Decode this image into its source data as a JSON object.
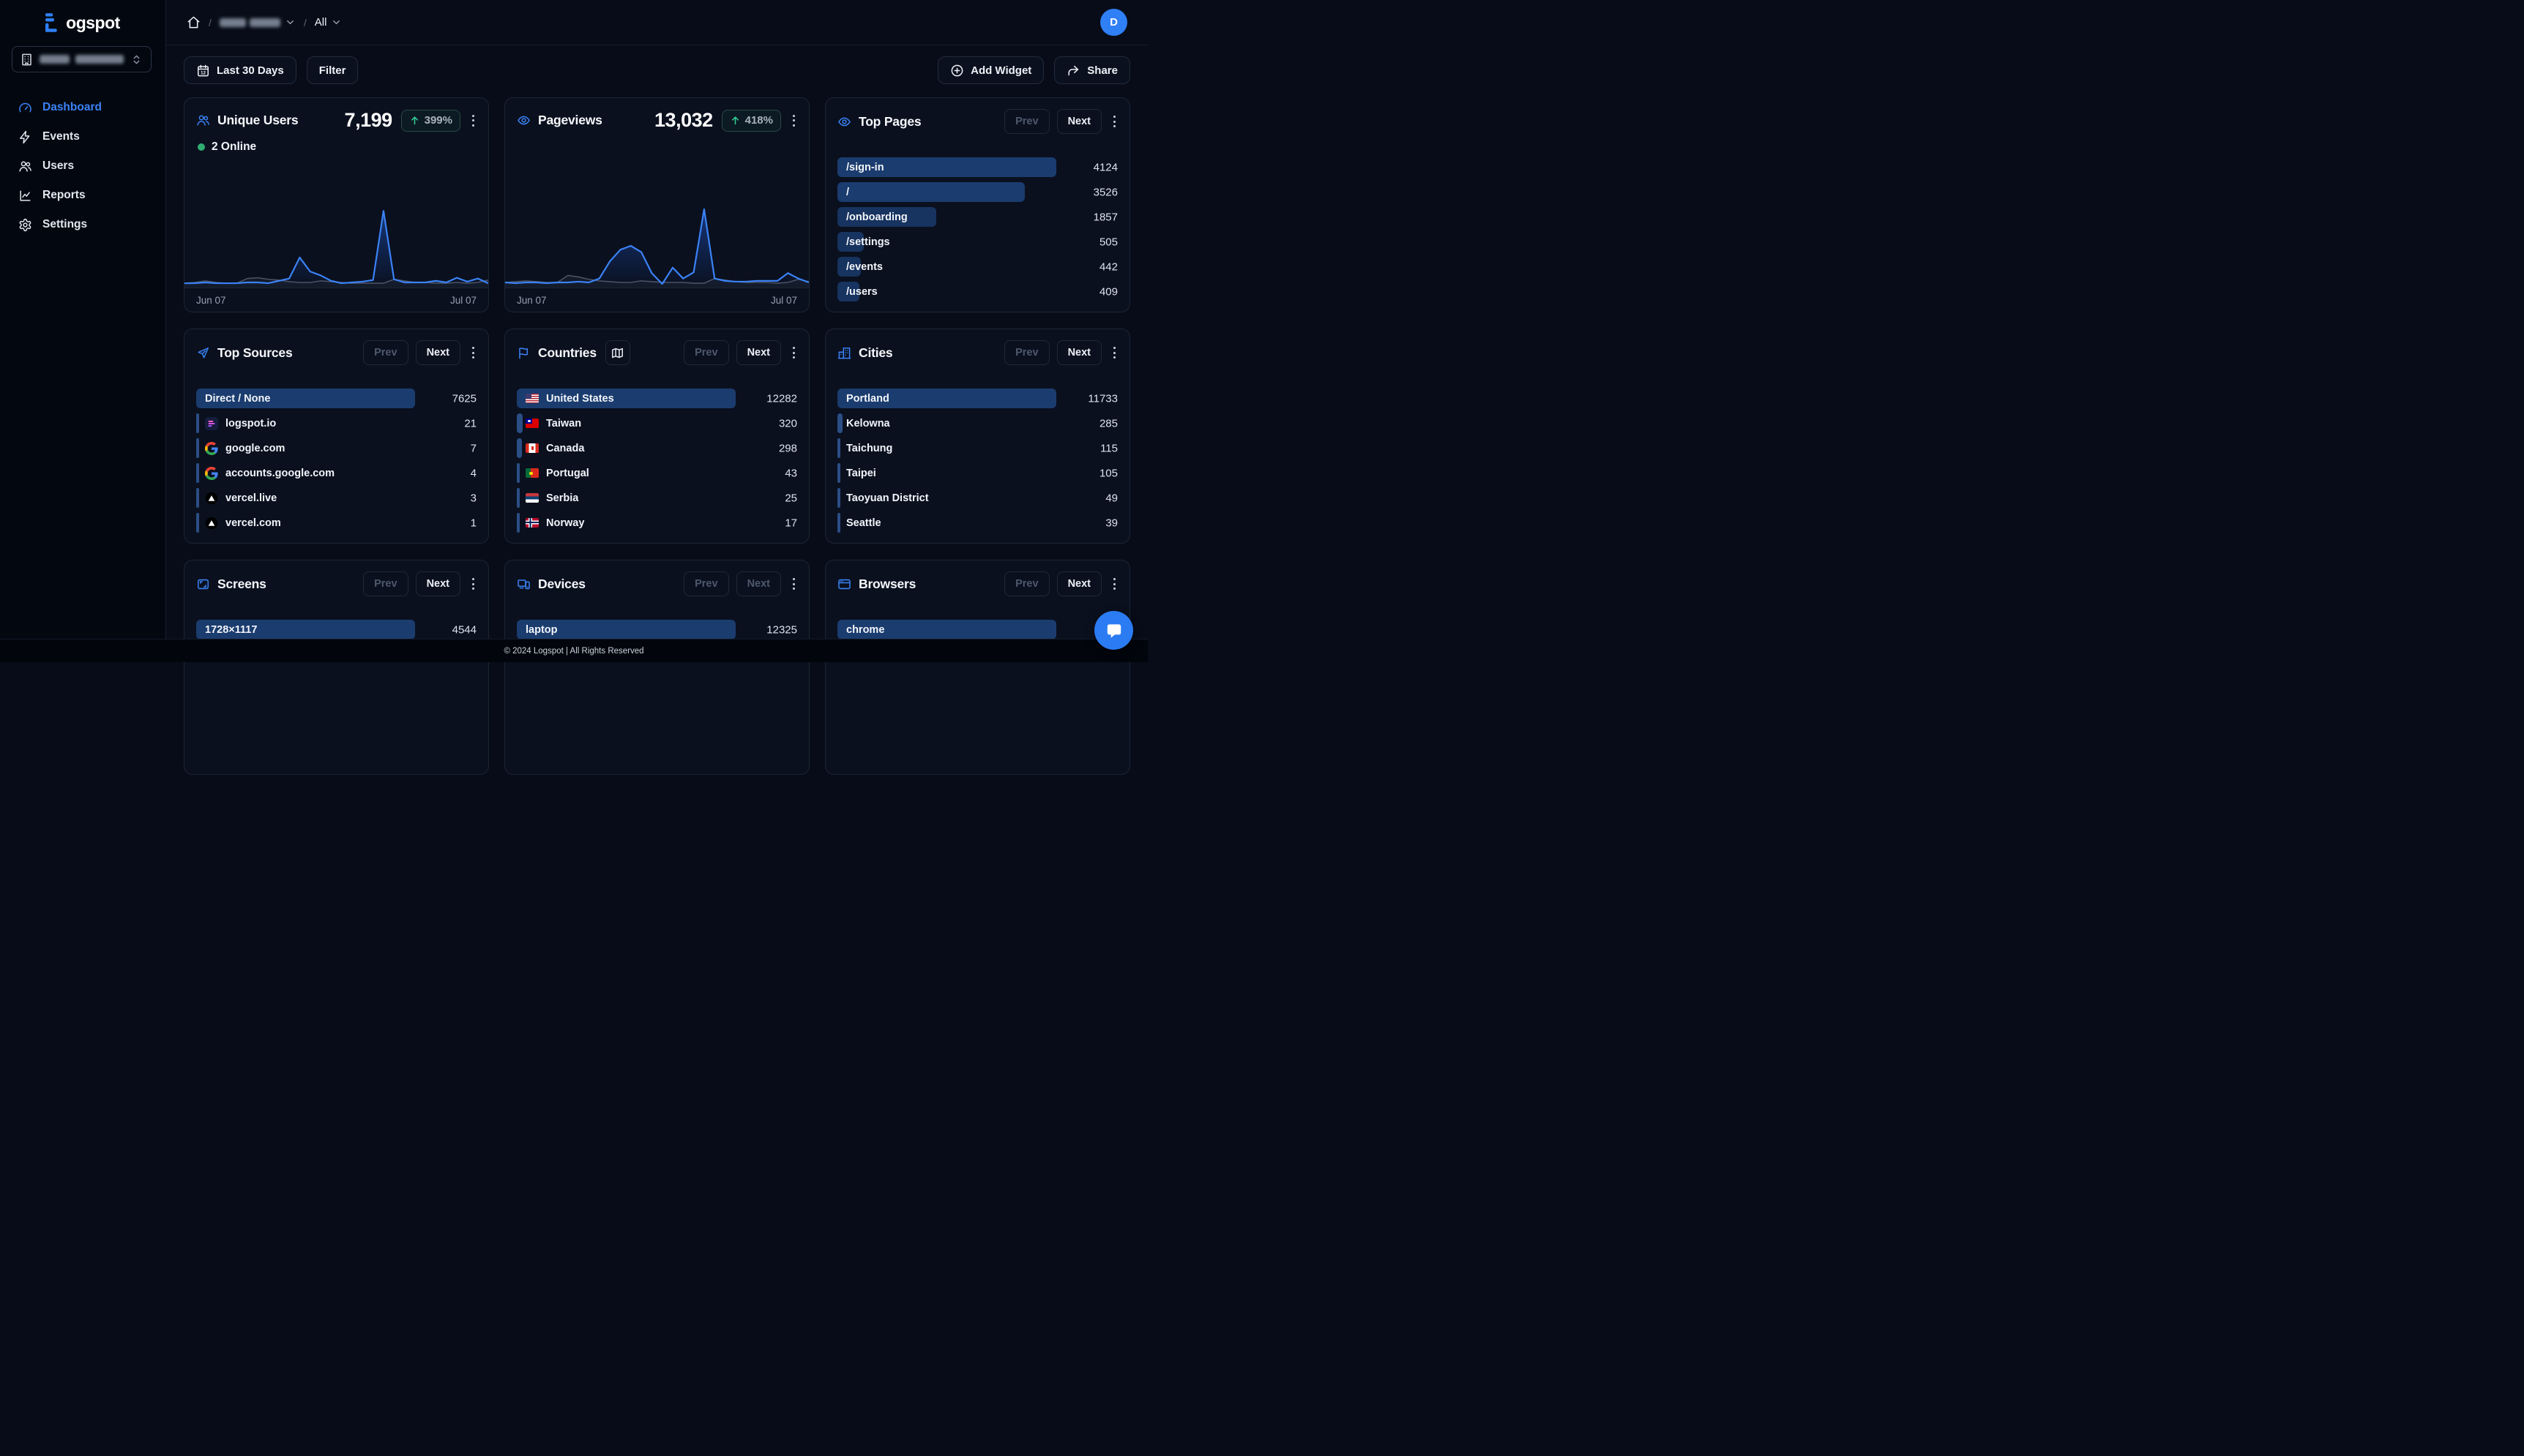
{
  "brand": {
    "name": "Logspot",
    "logo_suffix": "ogspot"
  },
  "colors": {
    "accent": "#3b82f6",
    "avatar": "#2f7ff6",
    "bar": "#17335f",
    "bar_max": "#1b3c6e",
    "bar_sliver": "#2b4e85",
    "green_up": "#34d399",
    "online_dot": "#2fae73",
    "card_bg": "#0a101e",
    "card_border": "#1d2636",
    "page_bg": "#070c18"
  },
  "sidebar": {
    "workspace": {
      "redacted": true
    },
    "nav": [
      {
        "id": "dashboard",
        "label": "Dashboard",
        "icon": "gauge",
        "active": true
      },
      {
        "id": "events",
        "label": "Events",
        "icon": "zap",
        "active": false
      },
      {
        "id": "users",
        "label": "Users",
        "icon": "users",
        "active": false
      },
      {
        "id": "reports",
        "label": "Reports",
        "icon": "chart",
        "active": false
      },
      {
        "id": "settings",
        "label": "Settings",
        "icon": "gear",
        "active": false
      }
    ]
  },
  "topbar": {
    "scope_label": "All",
    "avatar_initial": "D",
    "project_redacted": true
  },
  "toolbar": {
    "date_range": "Last 30 Days",
    "filter": "Filter",
    "add_widget": "Add Widget",
    "share": "Share"
  },
  "pager": {
    "prev": "Prev",
    "next": "Next"
  },
  "grid_order": [
    "unique-users",
    "pageviews",
    "top-pages",
    "top-sources",
    "countries",
    "cities",
    "screens",
    "devices",
    "browsers"
  ],
  "stat_cards": [
    {
      "id": "unique-users",
      "title": "Unique Users",
      "icon": "users",
      "value": "7,199",
      "change": "399%",
      "online": "2 Online",
      "x_start": "Jun 07",
      "x_end": "Jul 07"
    },
    {
      "id": "pageviews",
      "title": "Pageviews",
      "icon": "eye",
      "value": "13,032",
      "change": "418%",
      "x_start": "Jun 07",
      "x_end": "Jul 07"
    }
  ],
  "chart_data": [
    {
      "type": "area",
      "card": "unique-users",
      "title": "Unique Users last 30 days",
      "x_range": [
        "Jun 07",
        "Jul 07"
      ],
      "ylim": [
        0,
        1
      ],
      "grid": false,
      "legend": "none",
      "series": [
        {
          "name": "current",
          "color": "#3b82f6",
          "values": [
            0.02,
            0.02,
            0.03,
            0.02,
            0.02,
            0.02,
            0.03,
            0.03,
            0.02,
            0.05,
            0.08,
            0.35,
            0.17,
            0.12,
            0.05,
            0.02,
            0.03,
            0.04,
            0.06,
            0.95,
            0.07,
            0.03,
            0.03,
            0.03,
            0.05,
            0.03,
            0.09,
            0.04,
            0.08,
            0.02
          ]
        },
        {
          "name": "previous",
          "color": "#4a5261",
          "values": [
            0.02,
            0.03,
            0.05,
            0.03,
            0.02,
            0.02,
            0.08,
            0.09,
            0.07,
            0.06,
            0.04,
            0.03,
            0.03,
            0.05,
            0.04,
            0.03,
            0.02,
            0.02,
            0.02,
            0.02,
            0.07,
            0.05,
            0.03,
            0.03,
            0.02,
            0.02,
            0.03,
            0.02,
            0.03,
            0.06
          ]
        }
      ]
    },
    {
      "type": "area",
      "card": "pageviews",
      "title": "Pageviews last 30 days",
      "x_range": [
        "Jun 07",
        "Jul 07"
      ],
      "ylim": [
        0,
        1
      ],
      "grid": false,
      "legend": "none",
      "series": [
        {
          "name": "current",
          "color": "#3b82f6",
          "values": [
            0.03,
            0.02,
            0.03,
            0.03,
            0.02,
            0.03,
            0.03,
            0.04,
            0.03,
            0.08,
            0.3,
            0.45,
            0.5,
            0.42,
            0.15,
            0.01,
            0.22,
            0.08,
            0.16,
            0.97,
            0.08,
            0.05,
            0.04,
            0.04,
            0.05,
            0.05,
            0.05,
            0.15,
            0.08,
            0.03
          ]
        },
        {
          "name": "previous",
          "color": "#4a5261",
          "values": [
            0.03,
            0.04,
            0.05,
            0.04,
            0.03,
            0.03,
            0.12,
            0.1,
            0.07,
            0.05,
            0.04,
            0.03,
            0.03,
            0.05,
            0.04,
            0.03,
            0.03,
            0.03,
            0.02,
            0.02,
            0.08,
            0.06,
            0.04,
            0.03,
            0.03,
            0.03,
            0.02,
            0.03,
            0.07,
            0.04
          ]
        }
      ]
    }
  ],
  "list_cards": [
    {
      "id": "top-pages",
      "title": "Top Pages",
      "icon": "eye",
      "prev_enabled": false,
      "next_enabled": true,
      "items": [
        {
          "label": "/sign-in",
          "value": "4124"
        },
        {
          "label": "/",
          "value": "3526"
        },
        {
          "label": "/onboarding",
          "value": "1857"
        },
        {
          "label": "/settings",
          "value": "505"
        },
        {
          "label": "/events",
          "value": "442"
        },
        {
          "label": "/users",
          "value": "409"
        }
      ]
    },
    {
      "id": "top-sources",
      "title": "Top Sources",
      "icon": "send",
      "prev_enabled": false,
      "next_enabled": true,
      "items": [
        {
          "label": "Direct / None",
          "value": "7625"
        },
        {
          "label": "logspot.io",
          "value": "21",
          "favicon": "logspot"
        },
        {
          "label": "google.com",
          "value": "7",
          "favicon": "google"
        },
        {
          "label": "accounts.google.com",
          "value": "4",
          "favicon": "google"
        },
        {
          "label": "vercel.live",
          "value": "3",
          "favicon": "vercel"
        },
        {
          "label": "vercel.com",
          "value": "1",
          "favicon": "vercel"
        }
      ]
    },
    {
      "id": "countries",
      "title": "Countries",
      "icon": "flag",
      "map_button": true,
      "prev_enabled": false,
      "next_enabled": true,
      "items": [
        {
          "label": "United States",
          "value": "12282",
          "flag": "us"
        },
        {
          "label": "Taiwan",
          "value": "320",
          "flag": "tw"
        },
        {
          "label": "Canada",
          "value": "298",
          "flag": "ca"
        },
        {
          "label": "Portugal",
          "value": "43",
          "flag": "pt"
        },
        {
          "label": "Serbia",
          "value": "25",
          "flag": "rs"
        },
        {
          "label": "Norway",
          "value": "17",
          "flag": "no"
        }
      ]
    },
    {
      "id": "cities",
      "title": "Cities",
      "icon": "buildings",
      "prev_enabled": false,
      "next_enabled": true,
      "items": [
        {
          "label": "Portland",
          "value": "11733"
        },
        {
          "label": "Kelowna",
          "value": "285"
        },
        {
          "label": "Taichung",
          "value": "115"
        },
        {
          "label": "Taipei",
          "value": "105"
        },
        {
          "label": "Taoyuan District",
          "value": "49"
        },
        {
          "label": "Seattle",
          "value": "39"
        }
      ]
    },
    {
      "id": "screens",
      "title": "Screens",
      "icon": "screen",
      "prev_enabled": false,
      "next_enabled": true,
      "items": [
        {
          "label": "1728×1117",
          "value": "4544"
        }
      ]
    },
    {
      "id": "devices",
      "title": "Devices",
      "icon": "devices",
      "prev_enabled": false,
      "next_enabled": false,
      "items": [
        {
          "label": "laptop",
          "value": "12325"
        }
      ]
    },
    {
      "id": "browsers",
      "title": "Browsers",
      "icon": "browser",
      "prev_enabled": false,
      "next_enabled": true,
      "items": [
        {
          "label": "chrome",
          "value": ""
        }
      ]
    }
  ],
  "footer": {
    "copyright": "© 2024 Logspot | All Rights Reserved"
  }
}
